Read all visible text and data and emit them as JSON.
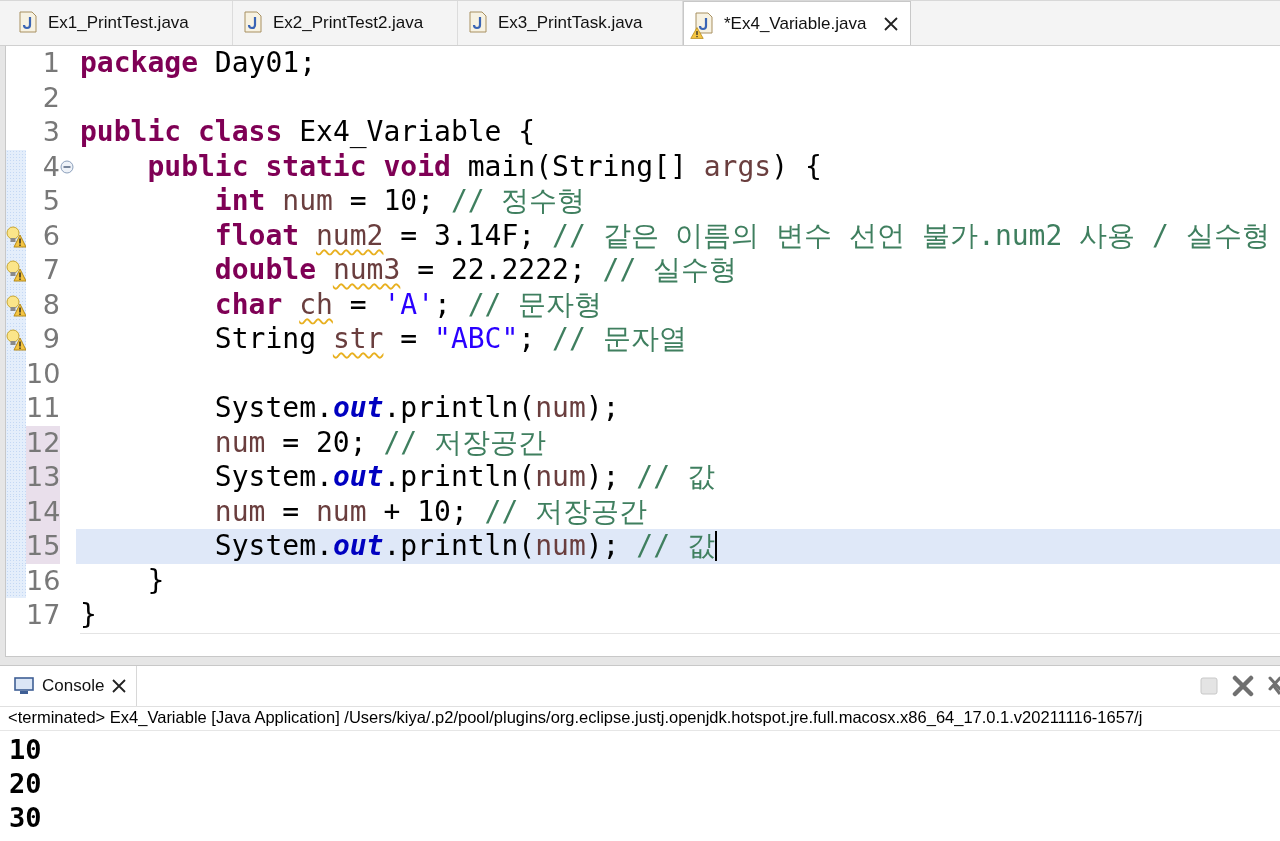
{
  "tabs": [
    {
      "label": "Ex1_PrintTest.java",
      "selected": false,
      "warning": false
    },
    {
      "label": "Ex2_PrintTest2.java",
      "selected": false,
      "warning": false
    },
    {
      "label": "Ex3_PrintTask.java",
      "selected": false,
      "warning": false
    },
    {
      "label": "*Ex4_Variable.java",
      "selected": true,
      "warning": true
    }
  ],
  "editor": {
    "lines": [
      {
        "number": "1",
        "warning": false,
        "fold": false,
        "range": false,
        "changed": false,
        "current": false,
        "tokens": [
          {
            "t": "package",
            "kind": "keyword"
          },
          {
            "t": " Day01;",
            "kind": "plain"
          }
        ]
      },
      {
        "number": "2",
        "warning": false,
        "fold": false,
        "range": false,
        "changed": false,
        "current": false
      },
      {
        "number": "3",
        "warning": false,
        "fold": false,
        "range": false,
        "changed": false,
        "current": false,
        "tokens": [
          {
            "t": "public",
            "kind": "keyword"
          },
          {
            "t": " class",
            "kind": "keyword"
          },
          {
            "t": " Ex4_Variable {",
            "kind": "plain"
          }
        ]
      },
      {
        "number": "4",
        "warning": false,
        "fold": true,
        "range": true,
        "changed": false,
        "current": false,
        "tokens": [
          {
            "t": "    public",
            "kind": "keyword"
          },
          {
            "t": " static",
            "kind": "keyword"
          },
          {
            "t": " void",
            "kind": "keyword"
          },
          {
            "t": " main(String[]",
            "kind": "plain"
          },
          {
            "t": " args",
            "kind": "variable"
          },
          {
            "t": ") {",
            "kind": "plain"
          }
        ]
      },
      {
        "number": "5",
        "warning": false,
        "fold": false,
        "range": true,
        "changed": false,
        "current": false,
        "tokens": [
          {
            "t": "        int",
            "kind": "keyword"
          },
          {
            "t": " num",
            "kind": "variable"
          },
          {
            "t": " = 10;",
            "kind": "plain"
          },
          {
            "t": " // 정수형",
            "kind": "comment"
          }
        ]
      },
      {
        "number": "6",
        "warning": true,
        "fold": false,
        "range": true,
        "changed": false,
        "current": false,
        "tokens": [
          {
            "t": "        float",
            "kind": "keyword"
          },
          {
            "t": " num2",
            "kind": "variable",
            "warn": true
          },
          {
            "t": " = 3.14F;",
            "kind": "plain"
          },
          {
            "t": " // 같은 이름의 변수 선언 불가.num2 사용 / 실수형",
            "kind": "comment"
          }
        ]
      },
      {
        "number": "7",
        "warning": true,
        "fold": false,
        "range": true,
        "changed": false,
        "current": false,
        "tokens": [
          {
            "t": "        double",
            "kind": "keyword"
          },
          {
            "t": " num3",
            "kind": "variable",
            "warn": true
          },
          {
            "t": " = 22.2222;",
            "kind": "plain"
          },
          {
            "t": " // 실수형",
            "kind": "comment"
          }
        ]
      },
      {
        "number": "8",
        "warning": true,
        "fold": false,
        "range": true,
        "changed": false,
        "current": false,
        "tokens": [
          {
            "t": "        char",
            "kind": "keyword"
          },
          {
            "t": " ch",
            "kind": "variable",
            "warn": true
          },
          {
            "t": " =",
            "kind": "plain"
          },
          {
            "t": " 'A'",
            "kind": "string"
          },
          {
            "t": ";",
            "kind": "plain"
          },
          {
            "t": " // 문자형",
            "kind": "comment"
          }
        ]
      },
      {
        "number": "9",
        "warning": true,
        "fold": false,
        "range": true,
        "changed": false,
        "current": false,
        "tokens": [
          {
            "t": "        String",
            "kind": "plain"
          },
          {
            "t": " str",
            "kind": "variable",
            "warn": true
          },
          {
            "t": " =",
            "kind": "plain"
          },
          {
            "t": " \"ABC\"",
            "kind": "string"
          },
          {
            "t": ";",
            "kind": "plain"
          },
          {
            "t": " // 문자열",
            "kind": "comment"
          }
        ]
      },
      {
        "number": "10",
        "warning": false,
        "fold": false,
        "range": true,
        "changed": false,
        "current": false
      },
      {
        "number": "11",
        "warning": false,
        "fold": false,
        "range": true,
        "changed": false,
        "current": false,
        "tokens": [
          {
            "t": "        System.",
            "kind": "plain"
          },
          {
            "t": "out",
            "kind": "field"
          },
          {
            "t": ".println(",
            "kind": "plain"
          },
          {
            "t": "num",
            "kind": "variable"
          },
          {
            "t": ");",
            "kind": "plain"
          }
        ]
      },
      {
        "number": "12",
        "warning": false,
        "fold": false,
        "range": true,
        "changed": true,
        "current": false,
        "tokens": [
          {
            "t": "        num",
            "kind": "variable"
          },
          {
            "t": " = 20;",
            "kind": "plain"
          },
          {
            "t": " // 저장공간",
            "kind": "comment"
          }
        ]
      },
      {
        "number": "13",
        "warning": false,
        "fold": false,
        "range": true,
        "changed": true,
        "current": false,
        "tokens": [
          {
            "t": "        System.",
            "kind": "plain"
          },
          {
            "t": "out",
            "kind": "field"
          },
          {
            "t": ".println(",
            "kind": "plain"
          },
          {
            "t": "num",
            "kind": "variable"
          },
          {
            "t": ");",
            "kind": "plain"
          },
          {
            "t": " // 값",
            "kind": "comment"
          }
        ]
      },
      {
        "number": "14",
        "warning": false,
        "fold": false,
        "range": true,
        "changed": true,
        "current": false,
        "tokens": [
          {
            "t": "        num",
            "kind": "variable"
          },
          {
            "t": " =",
            "kind": "plain"
          },
          {
            "t": " num",
            "kind": "variable"
          },
          {
            "t": " + 10;",
            "kind": "plain"
          },
          {
            "t": " // 저장공간",
            "kind": "comment"
          }
        ]
      },
      {
        "number": "15",
        "warning": false,
        "fold": false,
        "range": true,
        "changed": true,
        "current": true,
        "tokens": [
          {
            "t": "        System.",
            "kind": "plain"
          },
          {
            "t": "out",
            "kind": "field"
          },
          {
            "t": ".println(",
            "kind": "plain"
          },
          {
            "t": "num",
            "kind": "variable"
          },
          {
            "t": ");",
            "kind": "plain"
          },
          {
            "t": " // 값",
            "kind": "comment"
          }
        ]
      },
      {
        "number": "16",
        "warning": false,
        "fold": false,
        "range": true,
        "changed": false,
        "current": false,
        "tokens": [
          {
            "t": "    }",
            "kind": "plain"
          }
        ]
      },
      {
        "number": "17",
        "warning": false,
        "fold": false,
        "range": false,
        "changed": false,
        "current": false,
        "tokens": [
          {
            "t": "}",
            "kind": "plain"
          }
        ]
      }
    ]
  },
  "console": {
    "title": "Console",
    "status": "<terminated> Ex4_Variable [Java Application] /Users/kiya/.p2/pool/plugins/org.eclipse.justj.openjdk.hotspot.jre.full.macosx.x86_64_17.0.1.v20211116-1657/j",
    "output": [
      "10",
      "20",
      "30"
    ]
  }
}
